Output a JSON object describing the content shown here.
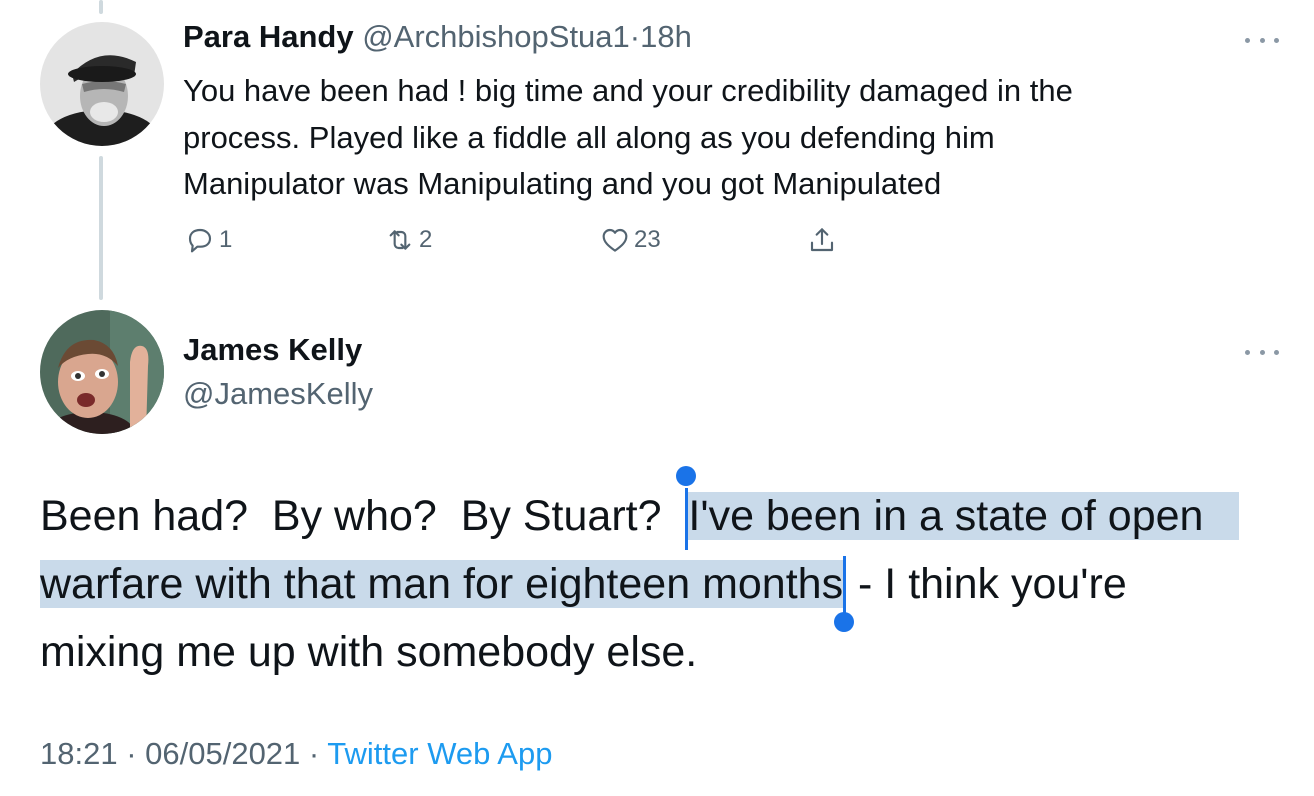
{
  "reply": {
    "author_name": "Para Handy",
    "handle": "@ArchbishopStua1",
    "separator": "·",
    "time": "18h",
    "text_lines": [
      "You have been had ! big time and your credibility damaged in the",
      "process. Played like a fiddle all along as you defending him",
      "Manipulator was Manipulating and you got Manipulated"
    ],
    "actions": {
      "reply_count": "1",
      "retweet_count": "2",
      "like_count": "23"
    }
  },
  "main_tweet": {
    "author_name": "James Kelly",
    "handle": "@JamesKelly",
    "text": {
      "line1_before": "Been had?  By who?  By Stuart?  ",
      "line1_selected": "I've been in a state of open",
      "line2_selected": "warfare with that man for eighteen months",
      "line2_after": " - I think you're",
      "line3": "mixing me up with somebody else."
    },
    "meta": {
      "time": "18:21",
      "separator": " · ",
      "date": "06/05/2021",
      "separator2": " · ",
      "app": "Twitter Web App"
    }
  },
  "icons": [
    "more-dots-icon",
    "reply-icon",
    "retweet-icon",
    "like-icon",
    "share-icon",
    "selection-handle-icon"
  ],
  "colors": {
    "selection": "#c9daea",
    "selection_handle": "#1a73e8",
    "link": "#1d9bf0",
    "muted": "#536471",
    "thread_line": "#cfd9de"
  }
}
